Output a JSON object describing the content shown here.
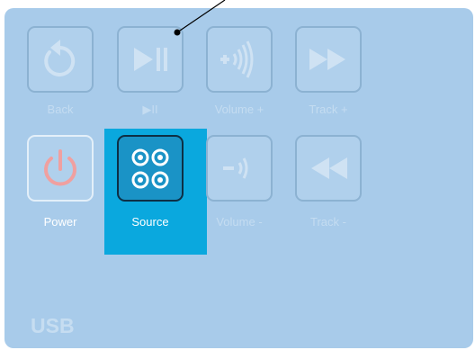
{
  "buttons_row1": [
    {
      "label": "Back"
    },
    {
      "label": "▶II"
    },
    {
      "label": "Volume +"
    },
    {
      "label": "Track +"
    }
  ],
  "buttons_row2": [
    {
      "label": "Power"
    },
    {
      "label": "Source"
    },
    {
      "label": "Volume -"
    },
    {
      "label": "Track -"
    }
  ],
  "source_label": "USB",
  "colors": {
    "screen_bg": "#a8cbea",
    "highlight": "#0aa8de",
    "power_icon": "#f0a0a0"
  }
}
